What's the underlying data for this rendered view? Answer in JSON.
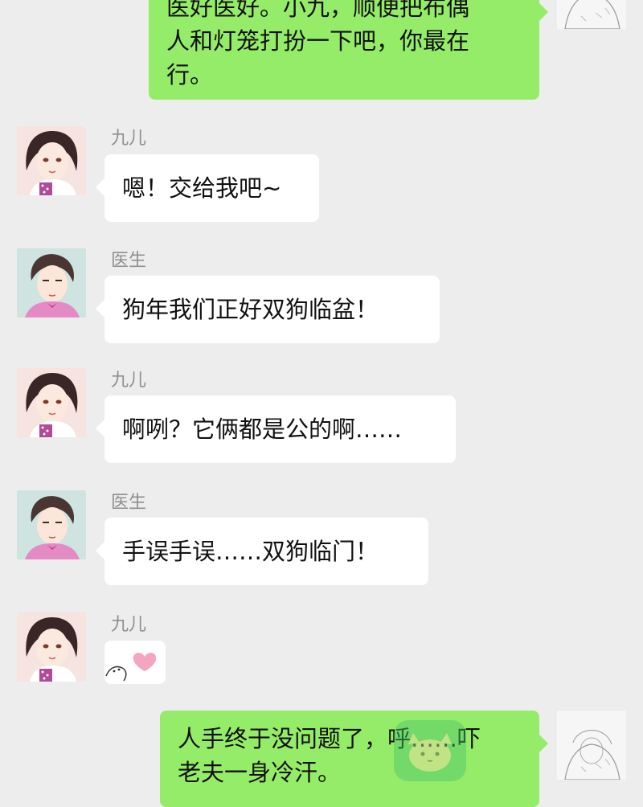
{
  "colors": {
    "background": "#ededed",
    "bubble_outgoing": "#95ec69",
    "bubble_incoming": "#ffffff",
    "name_text": "#8f8f8f"
  },
  "messages": [
    {
      "side": "right",
      "lines": [
        "医好医好。小九，顺便把布偶",
        "人和灯笼打扮一下吧，你最在",
        "行。"
      ]
    },
    {
      "side": "left",
      "sender": "九儿",
      "avatar": "jiuer-avatar",
      "text": "嗯！交给我吧~"
    },
    {
      "side": "left",
      "sender": "医生",
      "avatar": "doctor-avatar",
      "text": "狗年我们正好双狗临盆！"
    },
    {
      "side": "left",
      "sender": "九儿",
      "avatar": "jiuer-avatar",
      "text": "啊咧？它俩都是公的啊……"
    },
    {
      "side": "left",
      "sender": "医生",
      "avatar": "doctor-avatar",
      "text": "手误手误……双狗临门！"
    },
    {
      "side": "left",
      "sender": "九儿",
      "avatar": "jiuer-avatar",
      "sticker": "heart-sticker"
    },
    {
      "side": "right",
      "lines": [
        "人手终于没问题了，呼……吓",
        "老夫一身冷汗。"
      ]
    }
  ]
}
